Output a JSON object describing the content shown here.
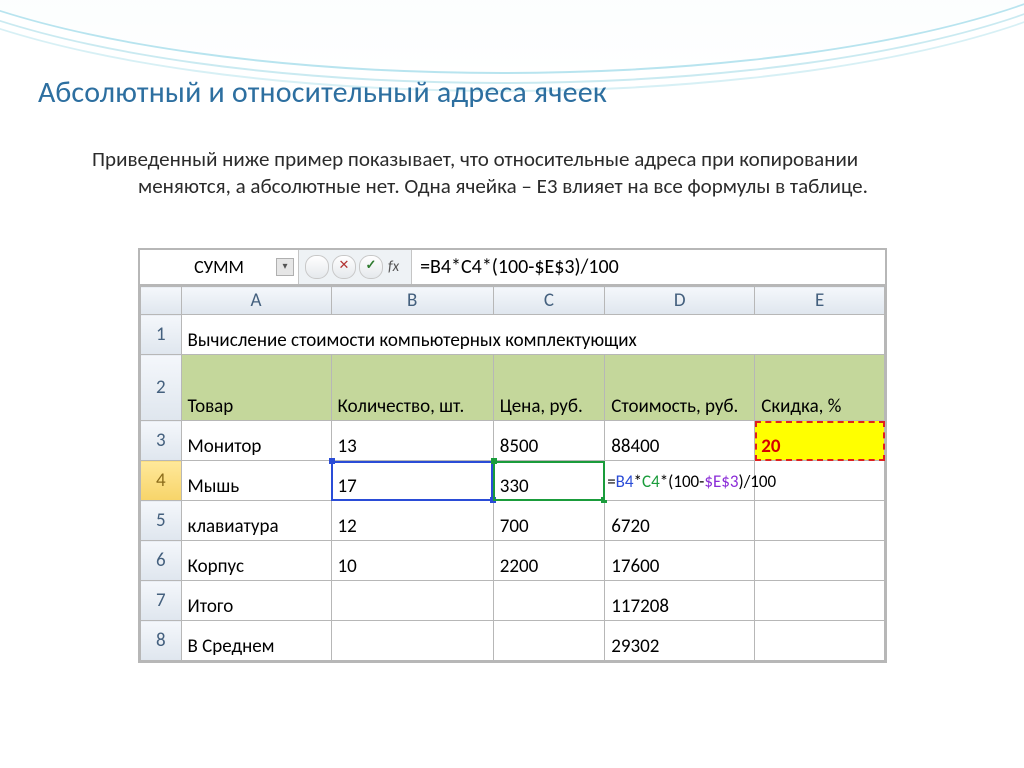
{
  "slide": {
    "title": "Абсолютный и относительный адреса ячеек",
    "paragraph": "Приведенный ниже пример показывает, что относительные адреса при копировании меняются, а абсолютные нет. Одна ячейка – E3 влияет на все формулы в таблице."
  },
  "formula_bar": {
    "name_box": "СУММ",
    "fx_label": "fx",
    "cancel_glyph": "✕",
    "confirm_glyph": "✓",
    "formula": "=B4*C4*(100-$E$3)/100"
  },
  "columns": [
    "A",
    "B",
    "C",
    "D",
    "E"
  ],
  "row_numbers": [
    "1",
    "2",
    "3",
    "4",
    "5",
    "6",
    "7",
    "8"
  ],
  "merged_header": "Вычисление стоимости компьютерных комплектующих",
  "headers2": {
    "A": "Товар",
    "B": "Количество, шт.",
    "C": "Цена, руб.",
    "D": "Стоимость, руб.",
    "E": "Скидка, %"
  },
  "rows": {
    "3": {
      "A": "Монитор",
      "B": "13",
      "C": "8500",
      "D": "88400",
      "E": "20"
    },
    "4": {
      "A": "Мышь",
      "B": "17",
      "C": "330"
    },
    "5": {
      "A": "клавиатура",
      "B": "12",
      "C": "700",
      "D": "6720"
    },
    "6": {
      "A": "Корпус",
      "B": "10",
      "C": "2200",
      "D": "17600"
    },
    "7": {
      "A": "Итого",
      "D": "117208"
    },
    "8": {
      "A": "В Среднем",
      "D": "29302"
    }
  },
  "d4_formula": {
    "eq": "=",
    "b4": "B4",
    "star1": "*",
    "c4": "C4",
    "mid": "*(100-",
    "e3": "$E$3",
    "tail": ")/100"
  },
  "chart_data": {
    "type": "table",
    "title": "Вычисление стоимости компьютерных комплектующих",
    "columns": [
      "Товар",
      "Количество, шт.",
      "Цена, руб.",
      "Стоимость, руб.",
      "Скидка, %"
    ],
    "rows": [
      [
        "Монитор",
        13,
        8500,
        88400,
        20
      ],
      [
        "Мышь",
        17,
        330,
        null,
        null
      ],
      [
        "клавиатура",
        12,
        700,
        6720,
        null
      ],
      [
        "Корпус",
        10,
        2200,
        17600,
        null
      ],
      [
        "Итого",
        null,
        null,
        117208,
        null
      ],
      [
        "В Среднем",
        null,
        null,
        29302,
        null
      ]
    ],
    "active_cell": "D4",
    "active_cell_formula": "=B4*C4*(100-$E$3)/100"
  }
}
